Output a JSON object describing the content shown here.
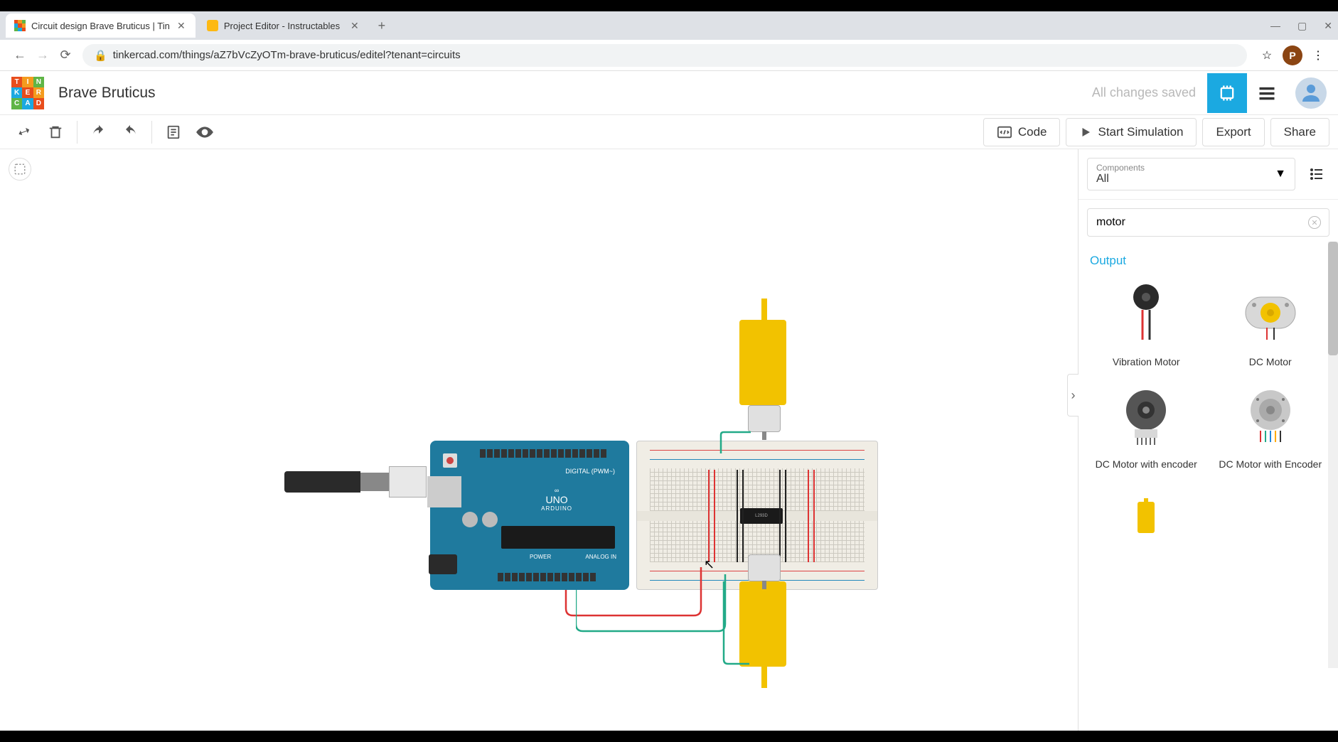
{
  "browser": {
    "tabs": [
      {
        "title": "Circuit design Brave Bruticus | Tin",
        "active": true
      },
      {
        "title": "Project Editor - Instructables",
        "active": false
      }
    ],
    "url": "tinkercad.com/things/aZ7bVcZyOTm-brave-bruticus/editel?tenant=circuits"
  },
  "header": {
    "project_title": "Brave Bruticus",
    "save_status": "All changes saved"
  },
  "toolbar": {
    "code": "Code",
    "start_simulation": "Start Simulation",
    "export": "Export",
    "share": "Share"
  },
  "sidepanel": {
    "components_label": "Components",
    "components_value": "All",
    "search_value": "motor",
    "category": "Output",
    "items": [
      {
        "label": "Vibration Motor"
      },
      {
        "label": "DC Motor"
      },
      {
        "label": "DC Motor with encoder"
      },
      {
        "label": "DC Motor with Encoder"
      }
    ]
  },
  "circuit": {
    "arduino_digital": "DIGITAL (PWM~)",
    "arduino_brand": "ARDUINO",
    "arduino_model": "UNO",
    "arduino_power": "POWER",
    "arduino_analog": "ANALOG IN",
    "ic_label": "L293D"
  },
  "logo_cells": [
    "T",
    "I",
    "N",
    "K",
    "E",
    "R",
    "C",
    "A",
    "D"
  ],
  "logo_colors": [
    "#e84d1c",
    "#f49b1e",
    "#5fb546",
    "#1ba9e1",
    "#e84d1c",
    "#f49b1e",
    "#5fb546",
    "#1ba9e1",
    "#e84d1c"
  ]
}
